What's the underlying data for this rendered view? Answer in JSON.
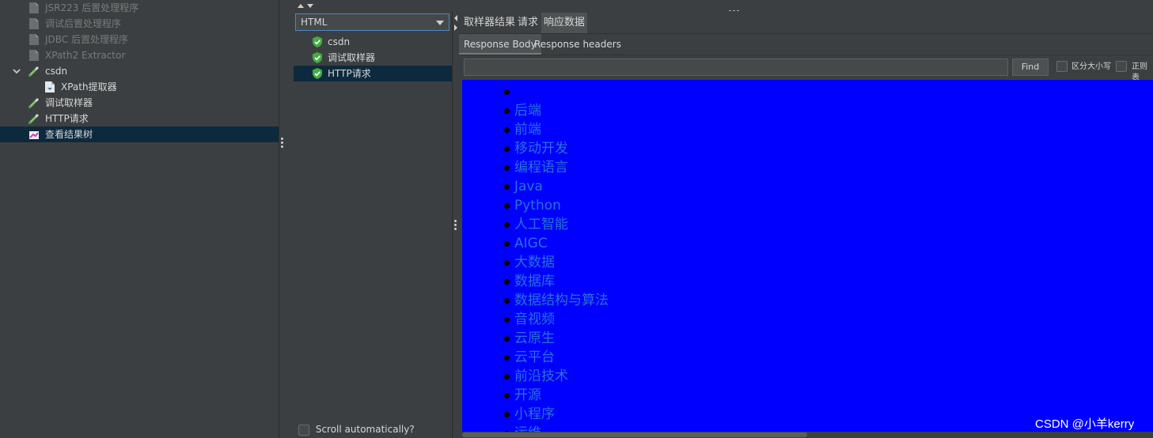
{
  "tree": {
    "items": [
      {
        "label": "JSR223 后置处理程序",
        "state": "disabled",
        "icon": "postprocessor-icon"
      },
      {
        "label": "调试后置处理程序",
        "state": "disabled",
        "icon": "postprocessor-icon"
      },
      {
        "label": "JDBC 后置处理程序",
        "state": "disabled",
        "icon": "postprocessor-icon"
      },
      {
        "label": "XPath2 Extractor",
        "state": "disabled",
        "icon": "postprocessor-icon"
      },
      {
        "label": "csdn",
        "state": "normal",
        "icon": "sampler-pipette-icon",
        "expanded": true
      },
      {
        "label": "XPath提取器",
        "state": "normal",
        "icon": "extractor-icon"
      },
      {
        "label": "调试取样器",
        "state": "normal",
        "icon": "sampler-pipette-icon"
      },
      {
        "label": "HTTP请求",
        "state": "normal",
        "icon": "sampler-pipette-icon"
      },
      {
        "label": "查看结果树",
        "state": "selected",
        "icon": "listener-chart-icon"
      }
    ]
  },
  "results": {
    "renderer": "HTML",
    "items": [
      {
        "label": "csdn",
        "status": "success"
      },
      {
        "label": "调试取样器",
        "status": "success"
      },
      {
        "label": "HTTP请求",
        "status": "success",
        "selected": true
      }
    ],
    "scroll_auto_label": "Scroll automatically?"
  },
  "tabs": {
    "main": [
      "取样器结果",
      "请求",
      "响应数据"
    ],
    "active_main": "响应数据",
    "sub": [
      "Response Body",
      "Response headers"
    ],
    "active_sub": "Response Body"
  },
  "search": {
    "value": "",
    "find_label": "Find",
    "case_label": "区分大小写",
    "regex_label": "正则表"
  },
  "response_list": [
    "",
    "后端",
    "前端",
    "移动开发",
    "编程语言",
    "Java",
    "Python",
    "人工智能",
    "AIGC",
    "大数据",
    "数据库",
    "数据结构与算法",
    "音视频",
    "云原生",
    "云平台",
    "前沿技术",
    "开源",
    "小程序",
    "运维"
  ],
  "watermark": "CSDN @小羊kerry",
  "colors": {
    "response_bg": "#0000ff",
    "link": "#2b6fd9",
    "selection": "#0d293e",
    "success_green": "#4fbf4f"
  }
}
